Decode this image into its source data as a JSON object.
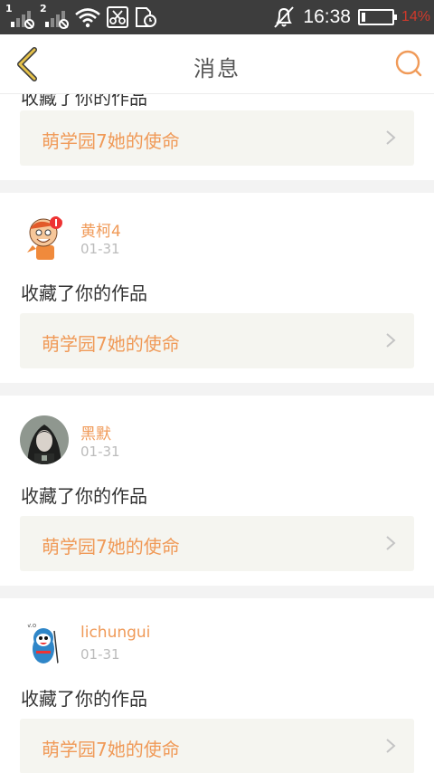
{
  "status_bar": {
    "sim1": "1",
    "sim2": "2",
    "time": "16:38",
    "battery": "14%",
    "battery_level": 0.14,
    "icons": [
      "signal-icon",
      "no-sim-icon",
      "wifi-icon",
      "scissors-icon",
      "sd-card-icon",
      "bell-off-icon",
      "battery-icon"
    ]
  },
  "header": {
    "title": "消息",
    "accent": "#f09a58",
    "back_icon": "chevron-left-icon",
    "search_icon": "search-icon"
  },
  "messages": [
    {
      "action": "收藏了你的作品",
      "work": "萌学园7她的使命"
    },
    {
      "user": "黄柯4",
      "date": "01-31",
      "action": "收藏了你的作品",
      "work": "萌学园7她的使命"
    },
    {
      "user": "黑默",
      "date": "01-31",
      "action": "收藏了你的作品",
      "work": "萌学园7她的使命"
    },
    {
      "user": "lichungui",
      "date": "01-31",
      "action": "收藏了你的作品",
      "work": "萌学园7她的使命"
    }
  ]
}
